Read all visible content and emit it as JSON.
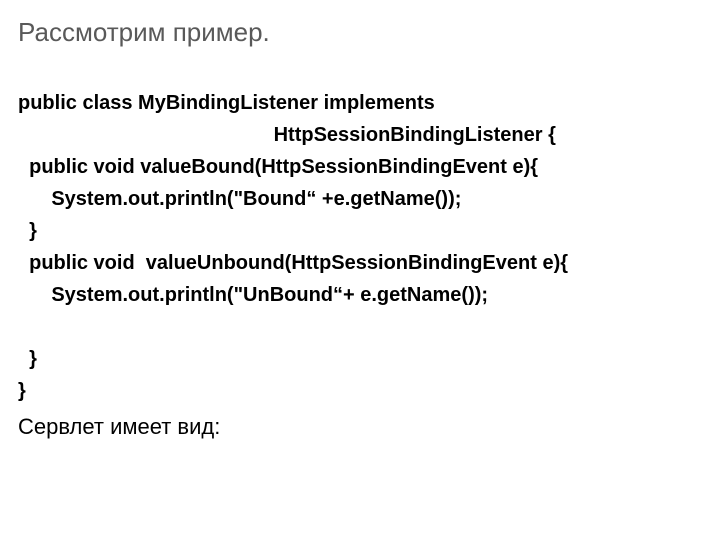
{
  "title": "Рассмотрим пример.",
  "code": {
    "l1": "public class MyBindingListener implements",
    "l2": "                                              HttpSessionBindingListener {",
    "l3": "  public void valueBound(HttpSessionBindingEvent e){",
    "l4": "      System.out.println(\"Bound“ +e.getName());",
    "l5": "  }",
    "l6": "  public void  valueUnbound(HttpSessionBindingEvent e){",
    "l7": "      System.out.println(\"UnBound“+ e.getName());",
    "l8": "",
    "l9": "  }",
    "l10": "}"
  },
  "closing": "Сервлет имеет вид:"
}
